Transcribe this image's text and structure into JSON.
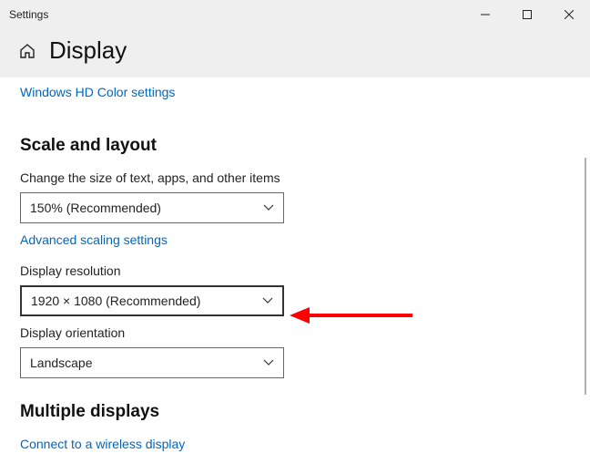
{
  "titlebar": {
    "title": "Settings"
  },
  "header": {
    "page_title": "Display"
  },
  "links": {
    "hd_color": "Windows HD Color settings",
    "adv_scaling": "Advanced scaling settings",
    "wireless": "Connect to a wireless display"
  },
  "sections": {
    "scale_layout": "Scale and layout",
    "multiple": "Multiple displays"
  },
  "fields": {
    "scale": {
      "label": "Change the size of text, apps, and other items",
      "value": "150% (Recommended)"
    },
    "resolution": {
      "label": "Display resolution",
      "value": "1920 × 1080 (Recommended)"
    },
    "orientation": {
      "label": "Display orientation",
      "value": "Landscape"
    }
  },
  "colors": {
    "link": "#0067c0",
    "arrow": "#ff0000"
  }
}
